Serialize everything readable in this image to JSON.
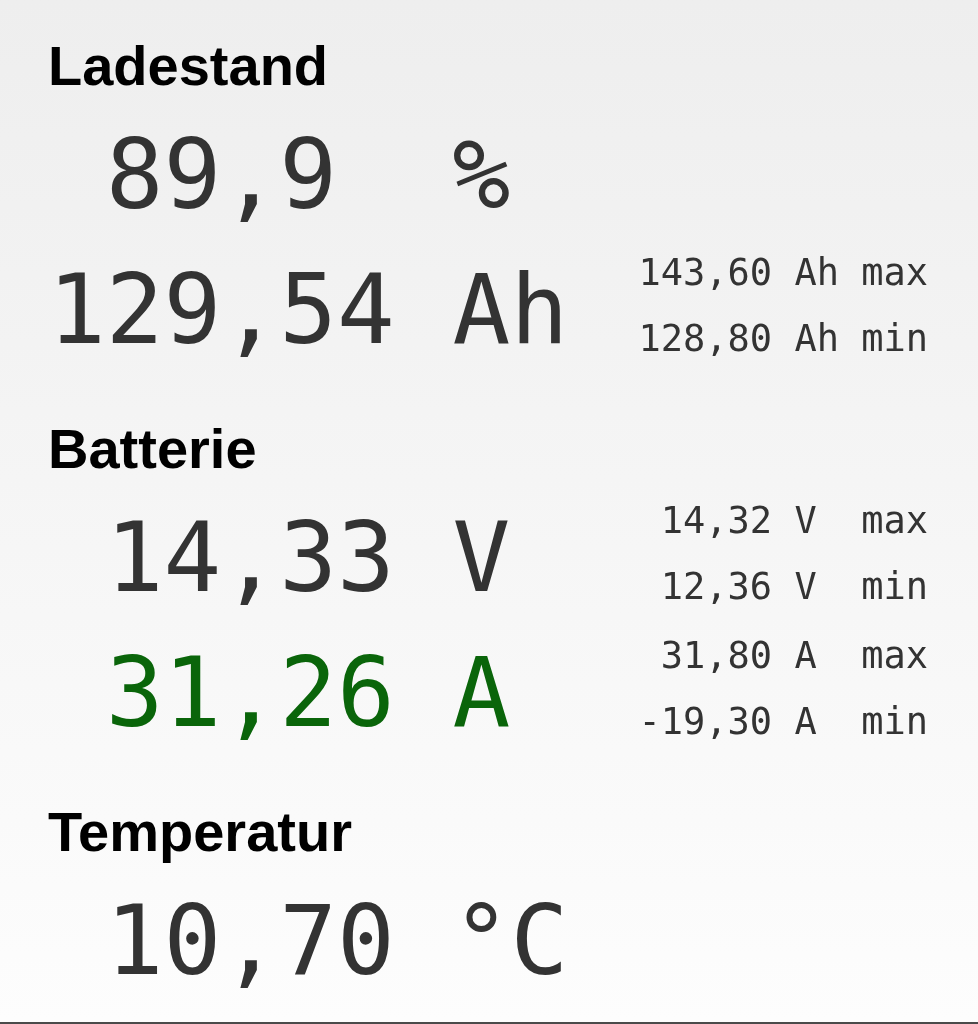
{
  "sections": [
    {
      "title": "Ladestand",
      "readings": [
        {
          "value": "89,9",
          "unit": "%",
          "color": "#333333"
        },
        {
          "value": "129,54",
          "unit": "Ah",
          "color": "#333333",
          "stats": [
            {
              "value": "143,60",
              "unit": "Ah",
              "label": "max"
            },
            {
              "value": "128,80",
              "unit": "Ah",
              "label": "min"
            }
          ]
        }
      ]
    },
    {
      "title": "Batterie",
      "readings": [
        {
          "value": "14,33",
          "unit": "V",
          "color": "#333333",
          "stats": [
            {
              "value": "14,32",
              "unit": "V",
              "label": "max"
            },
            {
              "value": "12,36",
              "unit": "V",
              "label": "min"
            }
          ]
        },
        {
          "value": "31,26",
          "unit": "A",
          "color": "#0a650a",
          "stats": [
            {
              "value": "31,80",
              "unit": "A",
              "label": "max"
            },
            {
              "value": "-19,30",
              "unit": "A",
              "label": "min"
            }
          ]
        }
      ]
    },
    {
      "title": "Temperatur",
      "readings": [
        {
          "value": "10,70",
          "unit": "°C",
          "color": "#333333"
        }
      ]
    }
  ]
}
